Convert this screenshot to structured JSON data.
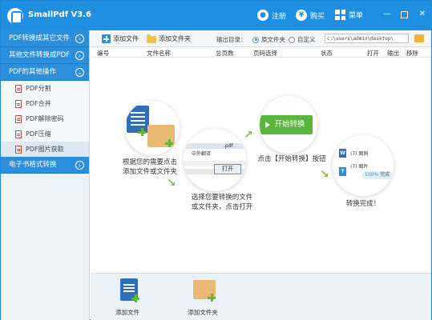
{
  "app": {
    "title": "SmallPdf V3.6",
    "register": "注册",
    "buy": "购买",
    "menu": "菜单"
  },
  "sidebar": {
    "groups": [
      {
        "label": "PDF转换成其它文件"
      },
      {
        "label": "其他文件转换成PDF"
      },
      {
        "label": "PDF的其他操作"
      }
    ],
    "items": [
      {
        "label": "PDF分割"
      },
      {
        "label": "PDF合并"
      },
      {
        "label": "PDF解除密码"
      },
      {
        "label": "PDF压缩"
      },
      {
        "label": "PDF图片获取"
      }
    ],
    "last_group": "电子书格式转换"
  },
  "toolbar": {
    "add_file": "添加文件",
    "add_folder": "添加文件夹",
    "output_dir": "输出目录：",
    "radio_source": "原文件夹",
    "radio_custom": "自定义",
    "path": "c:\\users\\admin\\desktop\\"
  },
  "table": {
    "headers": [
      "编号",
      "文件名称",
      "总页数",
      "页码选择",
      "状态",
      "打开",
      "输出",
      "移除"
    ]
  },
  "guide": {
    "step1": "根据您的需要点击\n添加文件或文件夹",
    "step2": "选择您要转换的文件\n或文件夹，点击打开",
    "step3": "点击【开始转换】按钮",
    "step4": "转换完成！",
    "start_button": "开始转换",
    "dialog_title": "中外翻译",
    "dialog_ext": ".pdf",
    "open_label": "打开",
    "row1": "(7) 图例",
    "row2": "(7) 图片",
    "percent": "100%",
    "done": "完成"
  },
  "bottom": {
    "add_file": "添加文件",
    "add_folder": "添加文件夹"
  },
  "colors": {
    "primary": "#1e8fe1",
    "green": "#5ab53b",
    "word_blue": "#2e6fbd",
    "folder": "#e9b873"
  }
}
